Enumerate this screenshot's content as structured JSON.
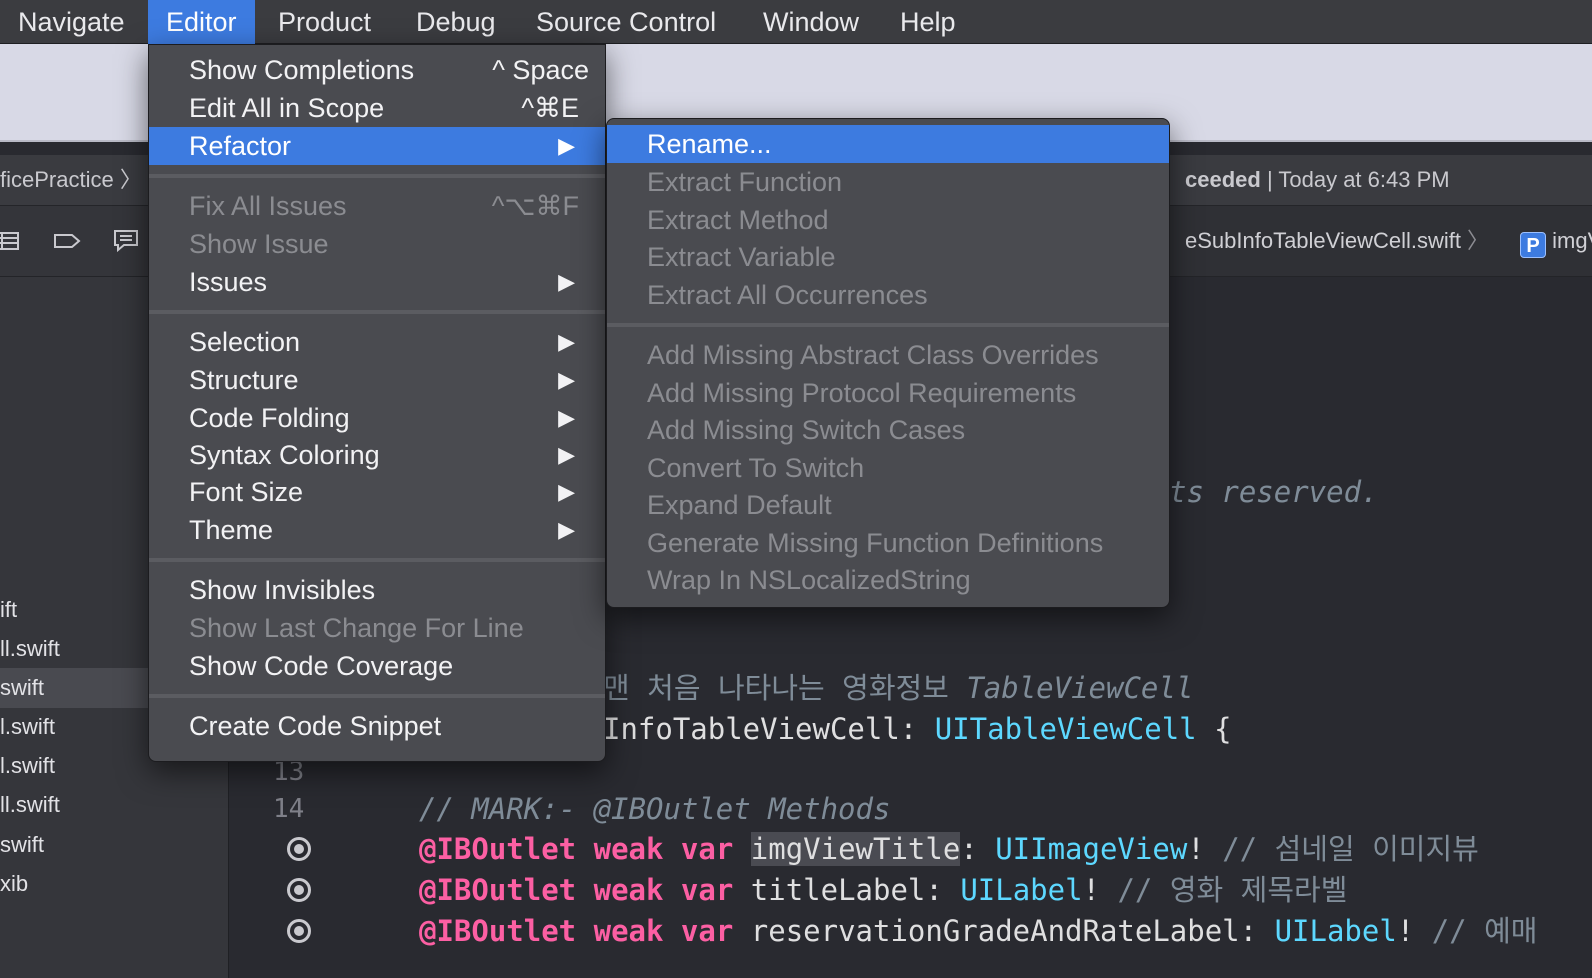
{
  "menubar": {
    "items": [
      "Navigate",
      "Editor",
      "Product",
      "Debug",
      "Source Control",
      "Window",
      "Help"
    ],
    "active": "Editor"
  },
  "activity": {
    "project": "ficePractice 〉",
    "status_bold": "ceeded",
    "status_rest": " | Today at 6:43 PM"
  },
  "jumpbar": {
    "file": "eSubInfoTableViewCell.swift",
    "separator": "〉",
    "badge": "P",
    "symbol": "imgV"
  },
  "navigator_icons": [
    "list-icon",
    "tag-icon",
    "comment-icon"
  ],
  "sidebar": {
    "files": [
      "ift",
      "ll.swift",
      "swift",
      "l.swift",
      "l.swift",
      "ll.swift",
      "swift",
      "xib"
    ],
    "selected_index": 2
  },
  "editor_menu": {
    "items": [
      {
        "label": "Show Completions",
        "shortcut": "^ Space"
      },
      {
        "label": "Edit All in Scope",
        "shortcut": "^⌘E"
      },
      {
        "label": "Refactor",
        "submenu": true,
        "highlighted": true
      },
      {
        "label": "Fix All Issues",
        "shortcut": "^⌥⌘F",
        "disabled": true
      },
      {
        "label": "Show Issue",
        "disabled": true
      },
      {
        "label": "Issues",
        "submenu": true
      },
      {
        "label": "Selection",
        "submenu": true
      },
      {
        "label": "Structure",
        "submenu": true
      },
      {
        "label": "Code Folding",
        "submenu": true
      },
      {
        "label": "Syntax Coloring",
        "submenu": true
      },
      {
        "label": "Font Size",
        "submenu": true
      },
      {
        "label": "Theme",
        "submenu": true
      },
      {
        "label": "Show Invisibles"
      },
      {
        "label": "Show Last Change For Line",
        "disabled": true
      },
      {
        "label": "Show Code Coverage"
      },
      {
        "label": "Create Code Snippet"
      }
    ],
    "submenu_arrow": "▶"
  },
  "refactor_menu": {
    "items": [
      {
        "label": "Rename...",
        "highlighted": true
      },
      {
        "label": "Extract Function",
        "disabled": true
      },
      {
        "label": "Extract Method",
        "disabled": true
      },
      {
        "label": "Extract Variable",
        "disabled": true
      },
      {
        "label": "Extract All Occurrences",
        "disabled": true
      },
      {
        "label": "Add Missing Abstract Class Overrides",
        "disabled": true
      },
      {
        "label": "Add Missing Protocol Requirements",
        "disabled": true
      },
      {
        "label": "Add Missing Switch Cases",
        "disabled": true
      },
      {
        "label": "Convert To Switch",
        "disabled": true
      },
      {
        "label": "Expand Default",
        "disabled": true
      },
      {
        "label": "Generate Missing Function Definitions",
        "disabled": true
      },
      {
        "label": "Wrap In NSLocalizedString",
        "disabled": true
      }
    ]
  },
  "code": {
    "reserved_fragment": "ts reserved.",
    "comment_korean": "맨 처음 나타나는 영화정보 ",
    "comment_type": "TableViewCell",
    "class_line_name": "InfoTableViewCell: ",
    "class_line_super": "UITableViewCell",
    "class_line_brace": " {",
    "line13": "13",
    "line14": "14",
    "mark_comment": "// MARK:- @IBOutlet Methods",
    "outlets": [
      {
        "attr": "@IBOutlet",
        "weak": "weak",
        "var": "var",
        "name": "imgViewTitle",
        "colon": ": ",
        "type": "UIImageView",
        "bang": "!",
        "comment": " // 섬네일 이미지뷰"
      },
      {
        "attr": "@IBOutlet",
        "weak": "weak",
        "var": "var",
        "name": "titleLabel",
        "colon": ": ",
        "type": "UILabel",
        "bang": "!",
        "comment": " // 영화 제목라벨"
      },
      {
        "attr": "@IBOutlet",
        "weak": "weak",
        "var": "var",
        "name": "reservationGradeAndRateLabel",
        "colon": ": ",
        "type": "UILabel",
        "bang": "!",
        "comment": " // 예매"
      }
    ]
  },
  "colors": {
    "menu_bg": "#4a4b50",
    "highlight": "#3d7be0",
    "keyword": "#fc5fa3",
    "type": "#5dd8ff",
    "comment": "#7f8c98"
  }
}
